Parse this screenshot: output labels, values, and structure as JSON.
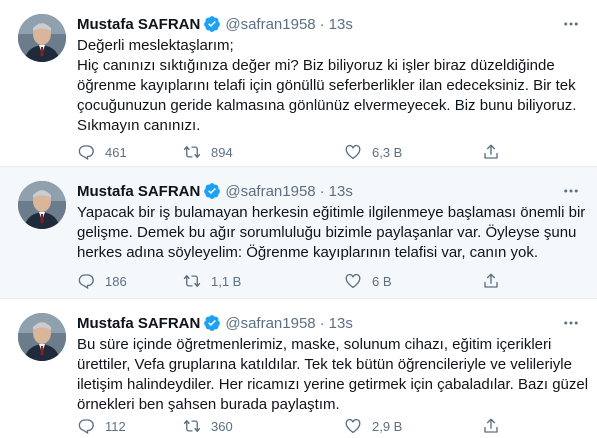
{
  "colors": {
    "accent": "#1da1f2",
    "muted": "#5b7083",
    "text": "#0f1419"
  },
  "tweets": [
    {
      "author": "Mustafa SAFRAN",
      "handle": "@safran1958",
      "separator": "·",
      "time": "13s",
      "lines": [
        "Değerli meslektaşlarım;",
        "Hiç canınızı sıktığınıza değer mi? Biz biliyoruz ki işler biraz düzeldiğinde",
        "öğrenme kayıplarını telafi için gönüllü seferberlikler ilan edeceksiniz. Bir tek",
        "çocuğunuzun geride kalmasına gönlünüz elvermeyecek. Biz bunu biliyoruz.",
        "Sıkmayın canınızı."
      ],
      "replies": "461",
      "retweets": "894",
      "likes": "6,3 B"
    },
    {
      "author": "Mustafa SAFRAN",
      "handle": "@safran1958",
      "separator": "·",
      "time": "13s",
      "lines": [
        "Yapacak bir iş bulamayan herkesin eğitimle ilgilenmeye başlaması önemli bir",
        "gelişme. Demek bu ağır sorumluluğu bizimle paylaşanlar var. Öyleyse şunu",
        "herkes adına söyleyelim: Öğrenme kayıplarının telafisi var, canın yok."
      ],
      "replies": "186",
      "retweets": "1,1 B",
      "likes": "6 B"
    },
    {
      "author": "Mustafa SAFRAN",
      "handle": "@safran1958",
      "separator": "·",
      "time": "13s",
      "lines": [
        "Bu süre içinde öğretmenlerimiz, maske, solunum cihazı, eğitim içerikleri",
        "ürettiler, Vefa gruplarına katıldılar. Tek tek bütün öğrencileriyle ve velileriyle",
        "iletişim halindeydiler. Her ricamızı yerine getirmek için çabaladılar. Bazı güzel",
        "örnekleri ben şahsen burada paylaştım."
      ],
      "replies": "112",
      "retweets": "360",
      "likes": "2,9 B"
    }
  ]
}
